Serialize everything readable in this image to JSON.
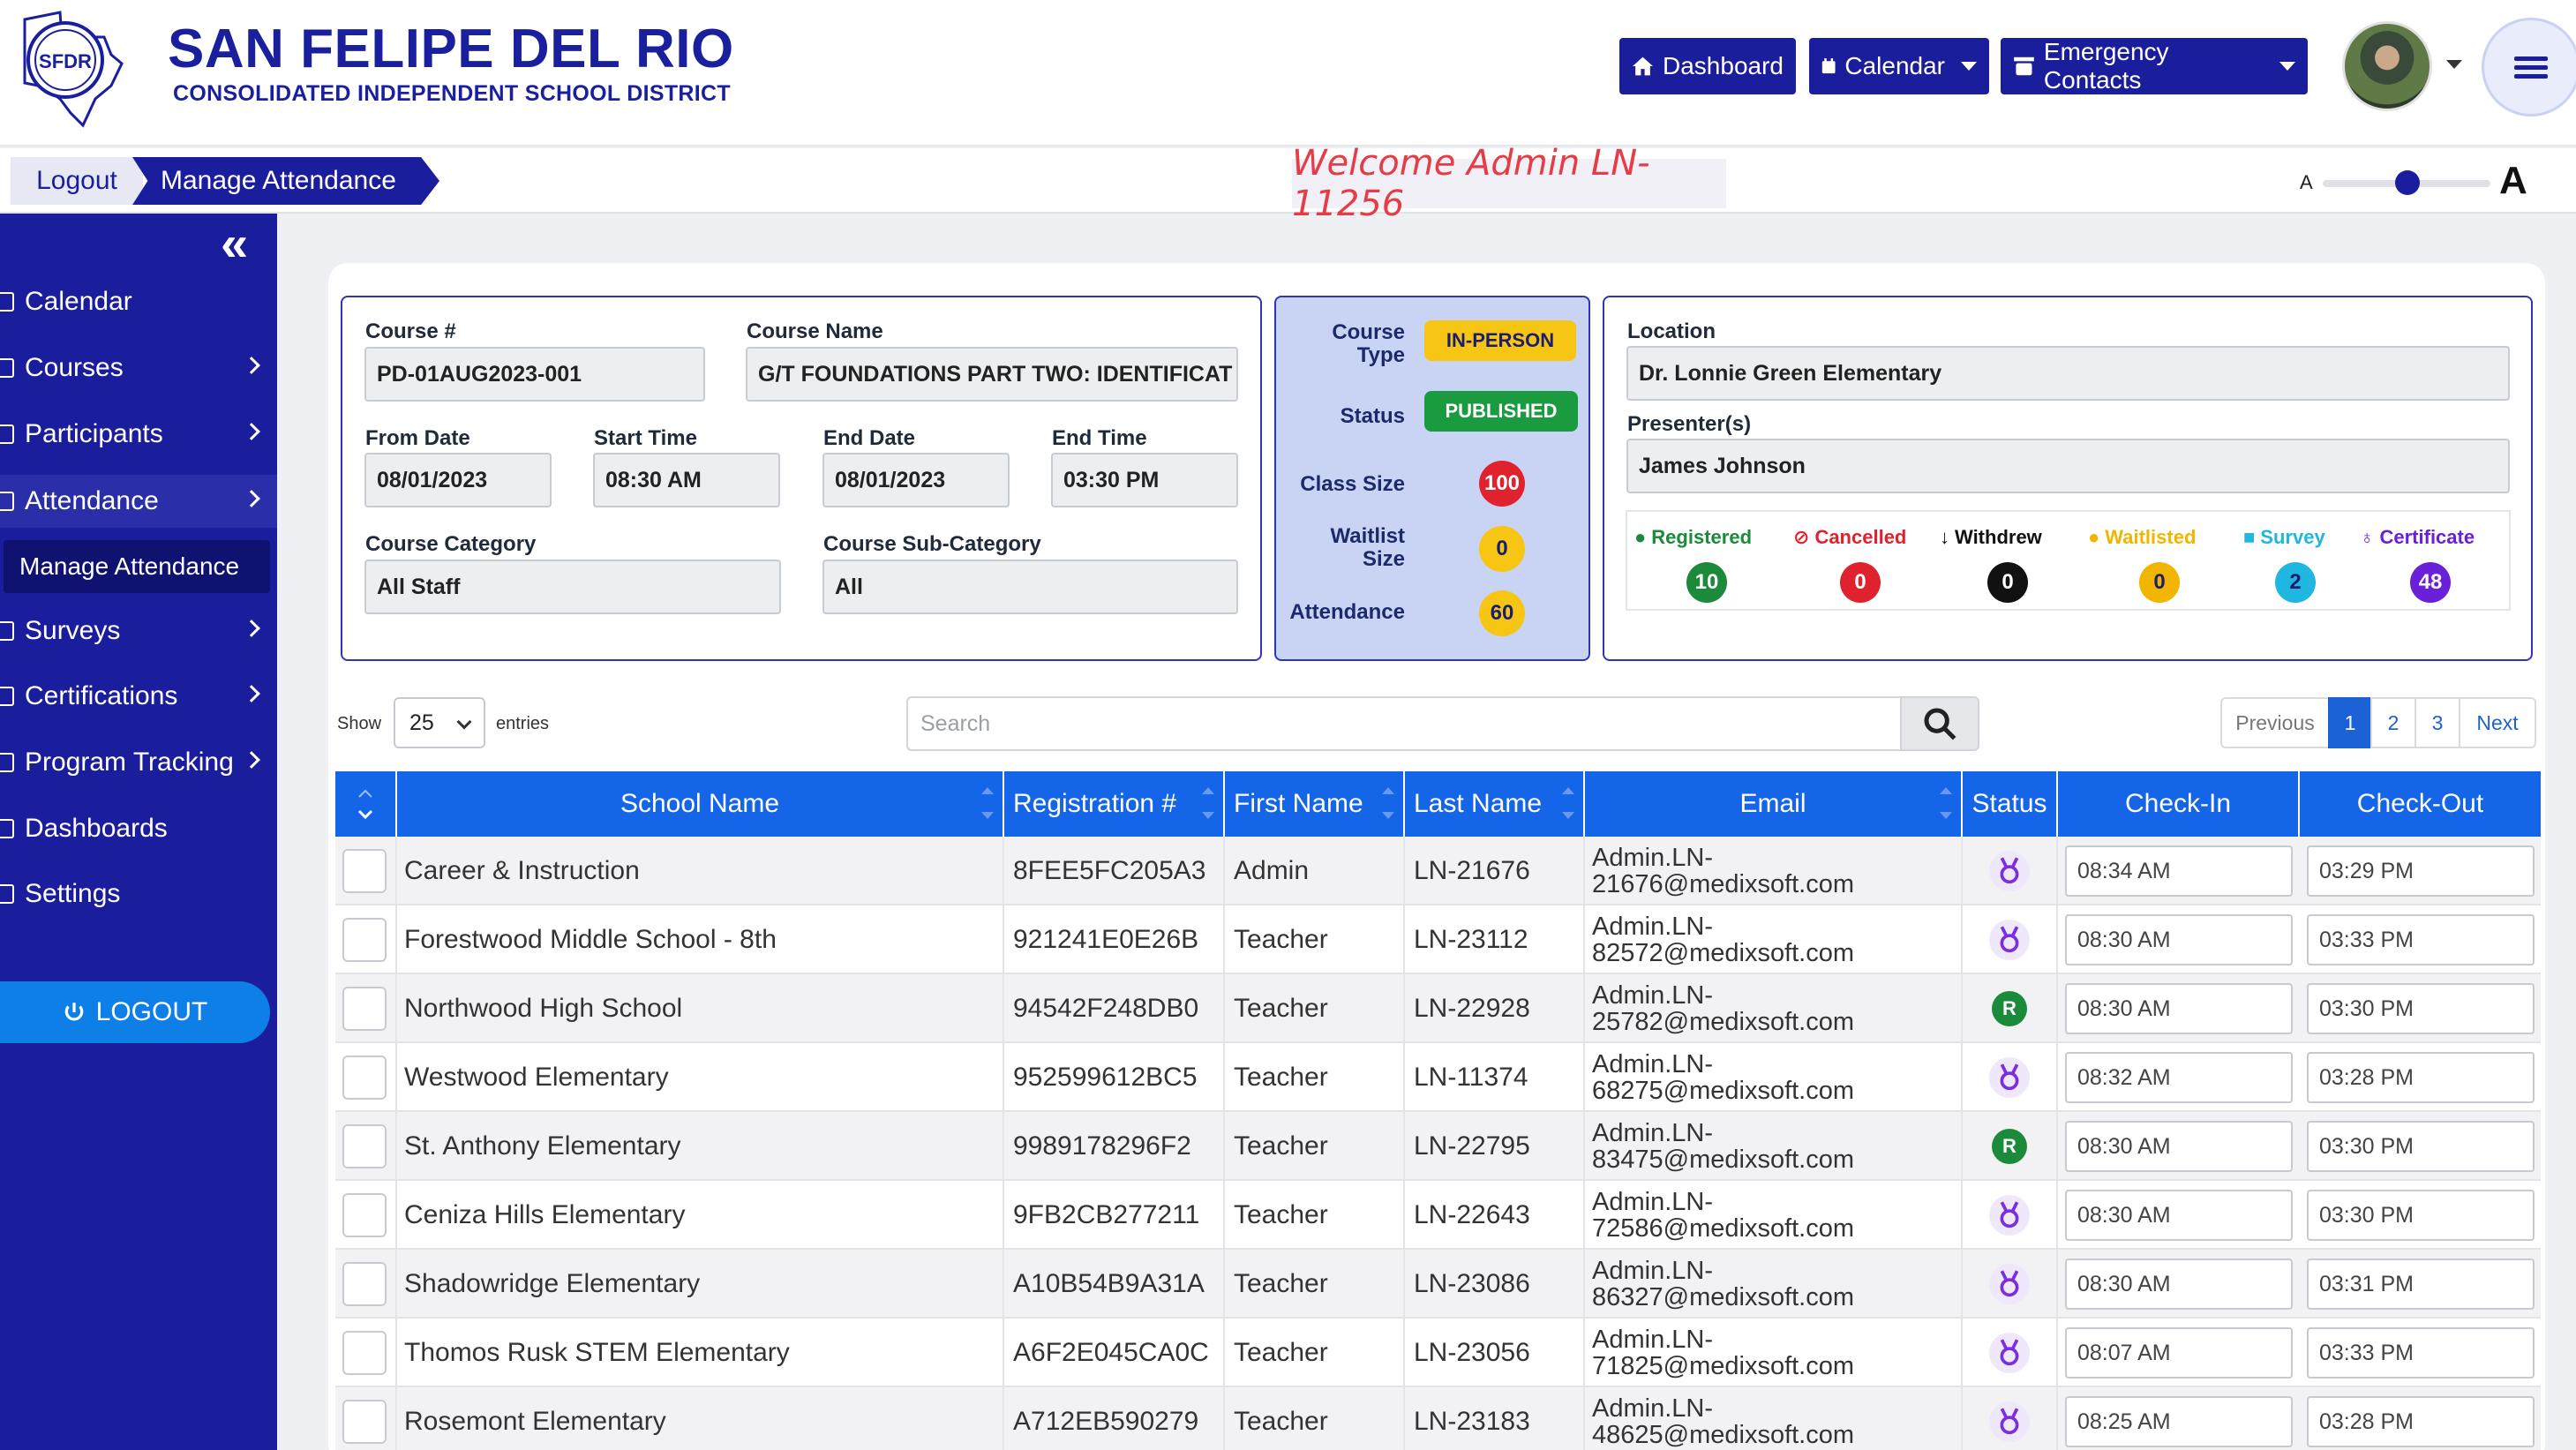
{
  "header": {
    "brand_title": "SAN FELIPE DEL RIO",
    "brand_subtitle": "CONSOLIDATED INDEPENDENT SCHOOL DISTRICT",
    "seal_text": "SFDR",
    "buttons": {
      "dashboard": "Dashboard",
      "calendar": "Calendar",
      "emergency": "Emergency Contacts"
    }
  },
  "breadcrumb": {
    "logout": "Logout",
    "current": "Manage Attendance"
  },
  "welcome": "Welcome Admin LN-11256",
  "font_size": {
    "small": "A",
    "large": "A"
  },
  "sidebar": {
    "items": [
      {
        "label": "Calendar"
      },
      {
        "label": "Courses"
      },
      {
        "label": "Participants"
      },
      {
        "label": "Attendance"
      },
      {
        "label": "Surveys"
      },
      {
        "label": "Certifications"
      },
      {
        "label": "Program Tracking"
      },
      {
        "label": "Dashboards"
      },
      {
        "label": "Settings"
      }
    ],
    "sub_item": "Manage Attendance",
    "logout": "LOGOUT"
  },
  "course": {
    "course_no_label": "Course #",
    "course_no": "PD-01AUG2023-001",
    "course_name_label": "Course Name",
    "course_name": "G/T FOUNDATIONS PART TWO: IDENTIFICAT",
    "from_date_label": "From Date",
    "from_date": "08/01/2023",
    "start_time_label": "Start Time",
    "start_time": "08:30 AM",
    "end_date_label": "End Date",
    "end_date": "08/01/2023",
    "end_time_label": "End Time",
    "end_time": "03:30 PM",
    "category_label": "Course Category",
    "category": "All Staff",
    "subcategory_label": "Course Sub-Category",
    "subcategory": "All"
  },
  "stats": {
    "type_label": "Course Type",
    "type": "IN-PERSON",
    "status_label": "Status",
    "status": "PUBLISHED",
    "class_size_label": "Class Size",
    "class_size": "100",
    "waitlist_label": "Waitlist Size",
    "waitlist": "0",
    "attendance_label": "Attendance",
    "attendance": "60"
  },
  "location": {
    "location_label": "Location",
    "location": "Dr. Lonnie Green Elementary",
    "presenter_label": "Presenter(s)",
    "presenter": "James Johnson"
  },
  "legend": [
    {
      "label": "Registered",
      "count": "10",
      "color": "#1b8a3a"
    },
    {
      "label": "Cancelled",
      "count": "0",
      "color": "#e0222e"
    },
    {
      "label": "Withdrew",
      "count": "0",
      "color": "#111111"
    },
    {
      "label": "Waitlisted",
      "count": "0",
      "color": "#f2b500"
    },
    {
      "label": "Survey",
      "count": "2",
      "color": "#1fb6e0"
    },
    {
      "label": "Certificate",
      "count": "48",
      "color": "#6a1fd8"
    }
  ],
  "controls": {
    "show": "Show",
    "entries_value": "25",
    "entries": "entries",
    "search_placeholder": "Search",
    "pagination": {
      "prev": "Previous",
      "p1": "1",
      "p2": "2",
      "p3": "3",
      "next": "Next"
    }
  },
  "table": {
    "headers": [
      "School Name",
      "Registration #",
      "First Name",
      "Last Name",
      "Email",
      "Status",
      "Check-In",
      "Check-Out"
    ],
    "rows": [
      {
        "school": "Career & Instruction",
        "reg": "8FEE5FC205A3",
        "first": "Admin",
        "last": "LN-21676",
        "email1": "Admin.LN-",
        "email2": "21676@medixsoft.com",
        "status": "certificate",
        "checkin": "08:34 AM",
        "checkout": "03:29 PM"
      },
      {
        "school": "Forestwood Middle School - 8th",
        "reg": "921241E0E26B",
        "first": "Teacher",
        "last": "LN-23112",
        "email1": "Admin.LN-",
        "email2": "82572@medixsoft.com",
        "status": "certificate",
        "checkin": "08:30 AM",
        "checkout": "03:33 PM"
      },
      {
        "school": "Northwood High School",
        "reg": "94542F248DB0",
        "first": "Teacher",
        "last": "LN-22928",
        "email1": "Admin.LN-",
        "email2": "25782@medixsoft.com",
        "status": "registered",
        "status_text": "R",
        "checkin": "08:30 AM",
        "checkout": "03:30 PM"
      },
      {
        "school": "Westwood Elementary",
        "reg": "952599612BC5",
        "first": "Teacher",
        "last": "LN-11374",
        "email1": "Admin.LN-",
        "email2": "68275@medixsoft.com",
        "status": "certificate",
        "checkin": "08:32 AM",
        "checkout": "03:28 PM"
      },
      {
        "school": "St. Anthony Elementary",
        "reg": "9989178296F2",
        "first": "Teacher",
        "last": "LN-22795",
        "email1": "Admin.LN-",
        "email2": "83475@medixsoft.com",
        "status": "registered",
        "status_text": "R",
        "checkin": "08:30 AM",
        "checkout": "03:30 PM"
      },
      {
        "school": "Ceniza Hills Elementary",
        "reg": "9FB2CB277211",
        "first": "Teacher",
        "last": "LN-22643",
        "email1": "Admin.LN-",
        "email2": "72586@medixsoft.com",
        "status": "certificate",
        "checkin": "08:30 AM",
        "checkout": "03:30 PM"
      },
      {
        "school": "Shadowridge Elementary",
        "reg": "A10B54B9A31A",
        "first": "Teacher",
        "last": "LN-23086",
        "email1": "Admin.LN-",
        "email2": "86327@medixsoft.com",
        "status": "certificate",
        "checkin": "08:30 AM",
        "checkout": "03:31 PM"
      },
      {
        "school": "Thomos Rusk STEM Elementary",
        "reg": "A6F2E045CA0C",
        "first": "Teacher",
        "last": "LN-23056",
        "email1": "Admin.LN-",
        "email2": "71825@medixsoft.com",
        "status": "certificate",
        "checkin": "08:07 AM",
        "checkout": "03:33 PM"
      },
      {
        "school": "Rosemont Elementary",
        "reg": "A712EB590279",
        "first": "Teacher",
        "last": "LN-23183",
        "email1": "Admin.LN-",
        "email2": "48625@medixsoft.com",
        "status": "certificate",
        "checkin": "08:25 AM",
        "checkout": "03:28 PM"
      }
    ]
  }
}
